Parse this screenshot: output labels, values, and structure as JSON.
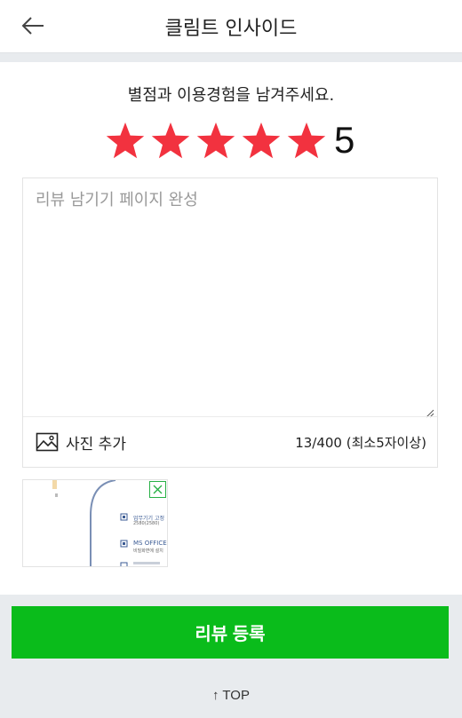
{
  "header": {
    "title": "클림트 인사이드"
  },
  "rating": {
    "prompt": "별점과 이용경험을 남겨주세요.",
    "score": "5",
    "max": 5,
    "star_color": "#f2323f"
  },
  "review": {
    "value": "",
    "placeholder": "리뷰 남기기 페이지 완성"
  },
  "photo": {
    "add_label": "사진 추가"
  },
  "counter": {
    "text": "13/400 (최소5자이상)"
  },
  "thumbnail": {
    "lines": [
      "업무기기 고정",
      "2580(2580)",
      "MS OFFICE",
      "비밀화면에 설치"
    ]
  },
  "submit": {
    "label": "리뷰 등록",
    "color": "#0abc1b"
  },
  "footer": {
    "top_label": "↑ TOP"
  }
}
